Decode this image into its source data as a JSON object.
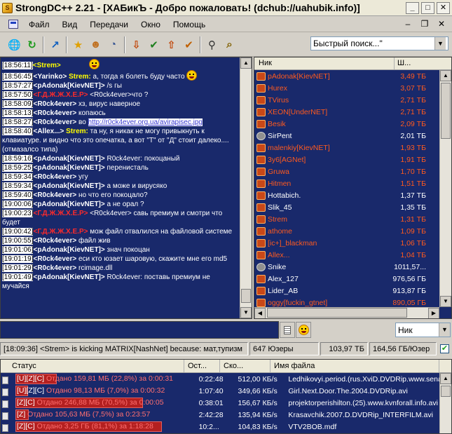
{
  "window": {
    "title": "StrongDC++ 2.21 - [ХАБикЪ - Добро пожаловать! (dchub://uahubik.info)]",
    "minimize": "_",
    "maximize": "□",
    "close": "✕"
  },
  "menu": {
    "items": [
      "Файл",
      "Вид",
      "Передачи",
      "Окно",
      "Помощь"
    ],
    "mdi": [
      "–",
      "❐",
      "✕"
    ]
  },
  "toolbar": {
    "quick_search_value": "Быстрый поиск...\"",
    "tools": [
      {
        "name": "public-hubs-icon",
        "glyph": "🌐",
        "color": "#1a6fd0"
      },
      {
        "name": "reconnect-icon",
        "glyph": "↻",
        "color": "#1a9a1a"
      },
      {
        "name": "follow-redirect-icon",
        "glyph": "↗",
        "color": "#1060c0"
      },
      {
        "name": "favorites-icon",
        "glyph": "★",
        "color": "#e0a000"
      },
      {
        "name": "users-icon",
        "glyph": "☻",
        "color": "#c07020"
      },
      {
        "name": "recent-icon",
        "glyph": "◔",
        "color": "#305090"
      },
      {
        "name": "queue-icon",
        "glyph": "⇩",
        "color": "#c04000"
      },
      {
        "name": "finished-downloads-icon",
        "glyph": "✔",
        "color": "#208020"
      },
      {
        "name": "upload-queue-icon",
        "glyph": "⇧",
        "color": "#c04000"
      },
      {
        "name": "finished-uploads-icon",
        "glyph": "✔",
        "color": "#c06000"
      },
      {
        "name": "search-icon",
        "glyph": "⚲",
        "color": "#303030"
      },
      {
        "name": "adl-search-icon",
        "glyph": "⌕",
        "color": "#806000"
      }
    ]
  },
  "chat": {
    "lines": [
      {
        "ts": "[18:56:11]",
        "nick": "<Strem>",
        "nick_color": "y",
        "text": ""
      },
      {
        "ts": "[18:56:45]",
        "nick": "<Yarinko>",
        "nick_color": "w",
        "text": " Strem: ",
        "text_color": "y",
        "after": "а, тогда я болеть буду часто",
        "smile": true
      },
      {
        "ts": "[18:57:27]",
        "nick": "<pAdonak[KievNET]>",
        "nick_color": "w",
        "text": " /s гы"
      },
      {
        "ts": "[18:57:50]",
        "nick": "<Г.Д.Ж.Ж.Х.Е.Р>",
        "nick_color": "r",
        "text": " <R0ck4ever>что ?"
      },
      {
        "ts": "[18:58:09]",
        "nick": "<R0ck4ever>",
        "nick_color": "w",
        "text": " хз, вирус наверное"
      },
      {
        "ts": "[18:58:13]",
        "nick": "<R0ck4ever>",
        "nick_color": "w",
        "text": " копаюсь"
      },
      {
        "ts": "[18:58:27]",
        "nick": "<R0ck4ever>",
        "nick_color": "w",
        "text": " во ",
        "link": "http://r0ck4ever.org.ua/avirapisec.jpg"
      },
      {
        "ts": "[18:58:40]",
        "nick": "<Allex...>",
        "nick_color": "w",
        "text": " Strem: ",
        "text_color": "y",
        "after": "та ну, я никак не могу привыкнуть к клавиатуре.  и видно что это опечатка, а вот \"Т\" от \"Д\" стоит далеко.... (отмазалсо типа)"
      },
      {
        "ts": "[18:59:16]",
        "nick": "<pAdonak[KievNET]>",
        "nick_color": "w",
        "text": " R0ck4ever: покоцаный"
      },
      {
        "ts": "[18:59:25]",
        "nick": "<pAdonak[KievNET]>",
        "nick_color": "w",
        "text": " перенисталь"
      },
      {
        "ts": "[18:59:34]",
        "nick": "<R0ck4ever>",
        "nick_color": "w",
        "text": " угу"
      },
      {
        "ts": "[18:59:34]",
        "nick": "<pAdonak[KievNET]>",
        "nick_color": "w",
        "text": " а може и вирусяко"
      },
      {
        "ts": "[18:59:40]",
        "nick": "<R0ck4ever>",
        "nick_color": "w",
        "text": " но что его покоцало?"
      },
      {
        "ts": "[19:00:06]",
        "nick": "<pAdonak[KievNET]>",
        "nick_color": "w",
        "text": " а не орал ?"
      },
      {
        "ts": "[19:00:23]",
        "nick": "<Г.Д.Ж.Ж.Х.Е.Р>",
        "nick_color": "r",
        "text": " <R0ck4ever> савь премиум и смотри что будет"
      },
      {
        "ts": "[19:00:42]",
        "nick": "<Г.Д.Ж.Ж.Х.Е.Р>",
        "nick_color": "r",
        "text": " мож файл отвалился на файловой системе"
      },
      {
        "ts": "[19:00:55]",
        "nick": "<R0ck4ever>",
        "nick_color": "w",
        "text": " файл жив"
      },
      {
        "ts": "[19:01:06]",
        "nick": "<pAdonak[KievNET]>",
        "nick_color": "w",
        "text": " знач покоцан"
      },
      {
        "ts": "[19:01:19]",
        "nick": "<R0ck4ever>",
        "nick_color": "w",
        "text": " еси кто юзает шаровую, скажите мне его md5"
      },
      {
        "ts": "[19:01:29]",
        "nick": "<R0ck4ever>",
        "nick_color": "w",
        "text": " rcimage.dll"
      },
      {
        "ts": "[19:01:49]",
        "nick": "<pAdonak[KievNET]>",
        "nick_color": "w",
        "text": " R0ck4ever: поставь премиум не мучайся"
      }
    ]
  },
  "userlist": {
    "headers": {
      "nick": "Ник",
      "share": "Ш..."
    },
    "users": [
      {
        "nick": "pAdonak[KievNET]",
        "share": "3,49 ТБ",
        "op": true,
        "active": true
      },
      {
        "nick": "Hurex",
        "share": "3,07 ТБ",
        "op": true,
        "active": true
      },
      {
        "nick": "TVirus",
        "share": "2,71 ТБ",
        "op": true,
        "active": true
      },
      {
        "nick": "XEON[UnderNET]",
        "share": "2,71 ТБ",
        "op": true,
        "active": true
      },
      {
        "nick": "Besik",
        "share": "2,09 ТБ",
        "op": true,
        "active": true
      },
      {
        "nick": "SirPent",
        "share": "2,01 ТБ",
        "op": false,
        "active": false
      },
      {
        "nick": "malenkiy[KievNET]",
        "share": "1,93 ТБ",
        "op": true,
        "active": true
      },
      {
        "nick": "3y6[AGNet]",
        "share": "1,91 ТБ",
        "op": true,
        "active": true
      },
      {
        "nick": "Gruwa",
        "share": "1,70 ТБ",
        "op": true,
        "active": true
      },
      {
        "nick": "Hitmen",
        "share": "1,51 ТБ",
        "op": true,
        "active": true
      },
      {
        "nick": "Hottabich.",
        "share": "1,37 ТБ",
        "op": false,
        "active": true
      },
      {
        "nick": "Slik_45",
        "share": "1,35 ТБ",
        "op": false,
        "active": true
      },
      {
        "nick": "Strem",
        "share": "1,31 ТБ",
        "op": true,
        "active": true
      },
      {
        "nick": "athome",
        "share": "1,09 ТБ",
        "op": true,
        "active": true
      },
      {
        "nick": "[ic+]_blackman",
        "share": "1,06 ТБ",
        "op": true,
        "active": true
      },
      {
        "nick": "Allex...",
        "share": "1,04 ТБ",
        "op": true,
        "active": true
      },
      {
        "nick": "Snike",
        "share": "1011,57...",
        "op": false,
        "active": false
      },
      {
        "nick": "Alex_127",
        "share": "976,56 ГБ",
        "op": false,
        "active": true
      },
      {
        "nick": "Lider_AB",
        "share": "913,87 ГБ",
        "op": false,
        "active": true
      },
      {
        "nick": "oggy[fuckin_gtnet]",
        "share": "890,05 ГБ",
        "op": true,
        "active": true
      }
    ]
  },
  "input": {
    "filter_value": "Ник"
  },
  "status": {
    "message": "[18:09:36] <Strem> is kicking MATRIX[NashNet] because: мат,тупизм",
    "users": "647 Юзеры",
    "total_share": "103,97 ТБ",
    "per_user": "164,56 ГБ/Юзер",
    "check": "✔"
  },
  "transfers": {
    "headers": {
      "status": "Статус",
      "time": "Ост...",
      "speed": "Ско...",
      "file": "Имя файла"
    },
    "rows": [
      {
        "flags": "[U][Z][C]",
        "status": " Отдано 159,81 МБ (22,8%) за 0:00:31",
        "progress": 0.228,
        "time": "0:22:48",
        "speed": "512,00 КБ/s",
        "file": "Ledhikovyi.period.(rus.XviD.DVDRip.www.senator"
      },
      {
        "flags": "[U][Z][C]",
        "status": " Отдано 98,13 МБ (7,0%) за 0:00:32",
        "progress": 0.07,
        "time": "1:07:40",
        "speed": "349,66 КБ/s",
        "file": "Girl.Next.Door.The.2004.DVDRip.avi"
      },
      {
        "flags": "[Z][C]",
        "status": " Отдано 246,88 МБ (70,5%) за 0:00:05",
        "progress": 0.705,
        "time": "0:38:01",
        "speed": "156,67 КБ/s",
        "file": "projektorperishilton.(25).www.kvnforall.info.avi"
      },
      {
        "flags": "[Z]",
        "status": " Отдано 105,63 МБ (7,5%) за 0:23:57",
        "progress": 0.075,
        "time": "2:42:28",
        "speed": "135,94 КБ/s",
        "file": "Krasavchik.2007.D.DVDRip_INTERFILM.avi"
      },
      {
        "flags": "[Z][C]",
        "status": " Отдано 3,25 ГБ (81,1%) за 1:18:28",
        "progress": 0.811,
        "time": "10:2...",
        "speed": "104,83 КБ/s",
        "file": "VTV2BOB.mdf"
      }
    ]
  }
}
